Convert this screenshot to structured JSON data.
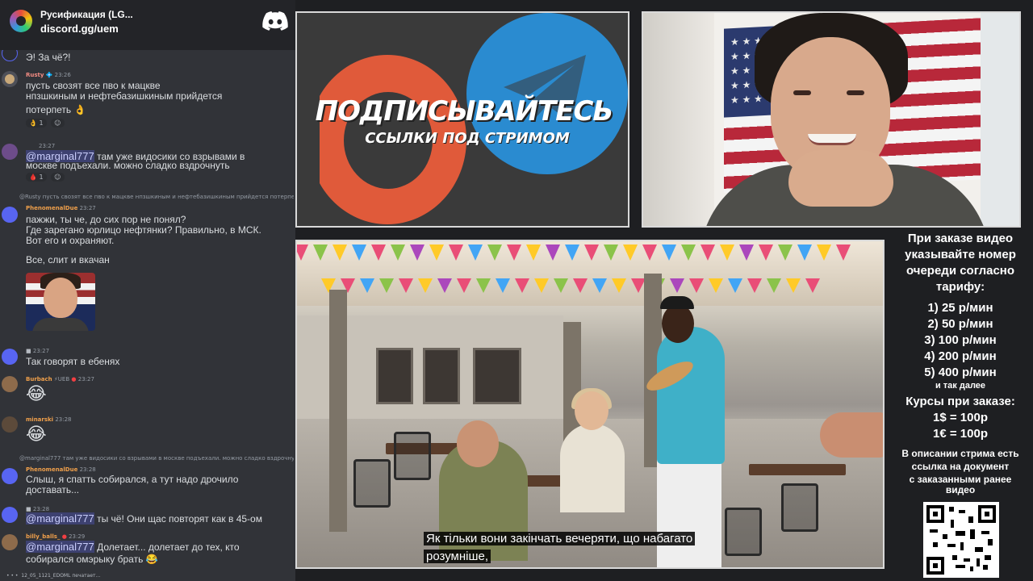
{
  "server": {
    "name": "Русификация (LG...",
    "link": "discord.gg/uem",
    "logo_icon": "discord-icon"
  },
  "chat": {
    "messages": [
      {
        "text": "Э! За чё?!"
      },
      {
        "user": "Rusty",
        "time": "23:26",
        "lines": [
          "пусть свозят все пво к мацкве",
          "нпзшкиным и нефтебазишкиным прийдется",
          "потерпеть"
        ],
        "emoji": "👌",
        "reactions": [
          "1",
          "1"
        ]
      },
      {
        "time": "23:27",
        "mention": "@marginal777",
        "line1": "там уже видосики со взрывами в",
        "line2": "москве подъехали. можно сладко вздрочнуть",
        "reactions": [
          "1",
          "1"
        ]
      },
      {
        "reply": "@Rusty пусть свозят все пво к мацкве  нпзшкиным и нефтебазишкиным прийдется потерпеть",
        "user": "PhenomenalDue",
        "time": "23:27",
        "lines": [
          "пажжи, ты че, до сих пор не понял?",
          "Где зарегано юрлицо нефтянки? Правильно, в МСК.",
          "Вот его и охраняют."
        ]
      },
      {
        "text": "Все, слит и вкачан"
      },
      {
        "time": "23:27",
        "text": "Так говорят в ебенях"
      },
      {
        "user": "Burbach",
        "badge": "UEB",
        "time": "23:27",
        "emoji": "😂"
      },
      {
        "user": "minarski",
        "time": "23:28",
        "emoji": "😂"
      },
      {
        "reply": "@marginal777 там уже видосики со взрывами в москве подъехали. можно сладко вздрочнуть",
        "user": "PhenomenalDue",
        "time": "23:28",
        "lines": [
          "Слыш, я спатть собирался, а тут надо дрочило",
          "доставать..."
        ]
      },
      {
        "time": "23:28",
        "mention": "@marginal777",
        "text": "ты чё! Они щас повторят как в 45-ом"
      },
      {
        "user": "billy_balls_",
        "time": "23:29",
        "mention": "@marginal777",
        "text": "Долетает... долетает до тех, кто",
        "line2": "собирался омэрыку брать",
        "emoji": "😂"
      }
    ],
    "status_line": "12_05_1121_EDOML печатает..."
  },
  "banner": {
    "title": "ПОДПИСЫВАЙТЕСЬ",
    "subtitle": "ССЫЛКИ ПОД СТРИМОМ"
  },
  "video": {
    "subtitle_line1": "Як тільки вони закінчать вечеряти, що набагато",
    "subtitle_line2": "розумніше,"
  },
  "pricing": {
    "intro": [
      "При заказе видео",
      "указывайте номер",
      "очереди согласно",
      "тарифу:"
    ],
    "tiers": [
      "1) 25 р/мин",
      "2) 50 р/мин",
      "3) 100 р/мин",
      "4) 200 р/мин",
      "5) 400 р/мин"
    ],
    "etc": "и так далее",
    "rates_title": "Курсы при заказе:",
    "rates": [
      "1$ = 100р",
      "1€ = 100р"
    ],
    "desc": [
      "В описании стрима есть",
      "ссылка на документ",
      "с заказанными ранее",
      "видео"
    ]
  },
  "colors": {
    "chat_bg": "#313338",
    "header_bg": "#232428",
    "mention_bg": "#3c4270",
    "username_red": "#f28b82",
    "username_orange": "#f0a04b",
    "telegram_blue": "#2a8bd0",
    "patreon_orange": "#e05a3a"
  }
}
